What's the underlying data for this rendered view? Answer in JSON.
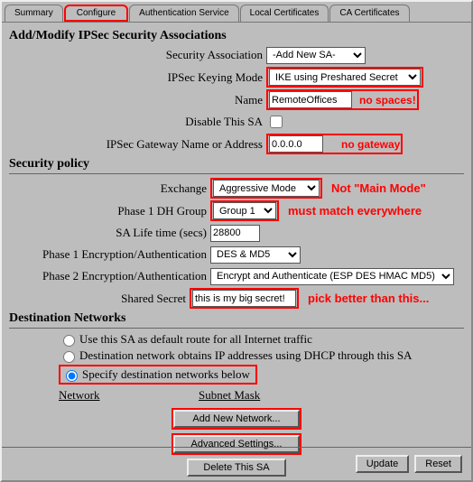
{
  "tabs": {
    "summary": "Summary",
    "configure": "Configure",
    "auth": "Authentication Service",
    "localcerts": "Local Certificates",
    "cacerts": "CA Certificates"
  },
  "headings": {
    "addmodify": "Add/Modify IPSec Security Associations",
    "security_policy": "Security policy",
    "dest_networks": "Destination Networks"
  },
  "labels": {
    "security_assoc": "Security Association",
    "keying_mode": "IPSec Keying Mode",
    "name": "Name",
    "disable_sa": "Disable This SA",
    "gw": "IPSec Gateway Name or Address",
    "exchange": "Exchange",
    "dh_group": "Phase 1 DH Group",
    "sa_life": "SA Life time (secs)",
    "p1ea": "Phase 1 Encryption/Authentication",
    "p2ea": "Phase 2 Encryption/Authentication",
    "shared_secret": "Shared Secret",
    "network": "Network",
    "subnet": "Subnet Mask"
  },
  "values": {
    "security_assoc": "-Add New SA-",
    "keying_mode": "IKE using Preshared Secret",
    "name": "RemoteOffices",
    "gw": "0.0.0.0",
    "exchange": "Aggressive Mode",
    "dh_group": "Group 1",
    "sa_life": "28800",
    "p1ea": "DES & MD5",
    "p2ea": "Encrypt and Authenticate (ESP DES HMAC MD5)",
    "shared_secret": "this is my big secret!"
  },
  "radios": {
    "r1": "Use this SA as default route for all Internet traffic",
    "r2": "Destination network obtains IP addresses using DHCP through this SA",
    "r3": "Specify destination networks below"
  },
  "buttons": {
    "add_net": "Add New Network...",
    "adv": "Advanced Settings...",
    "del_sa": "Delete This SA",
    "update": "Update",
    "reset": "Reset"
  },
  "annotations": {
    "no_spaces": "no spaces!",
    "no_gateway": "no gateway",
    "not_main": "Not \"Main Mode\"",
    "must_match": "must match everywhere",
    "pick_better": "pick better than this..."
  }
}
